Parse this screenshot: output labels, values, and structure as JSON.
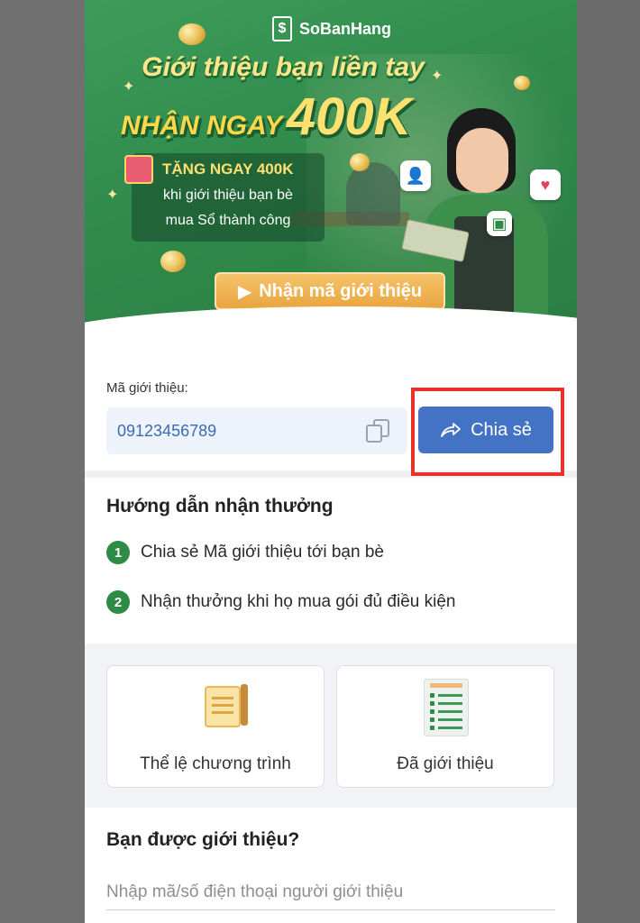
{
  "brand": {
    "name": "SoBanHang",
    "logo_glyph": "$"
  },
  "banner": {
    "headline_line1": "Giới thiệu bạn liền tay",
    "headline_line2_prefix": "NHẬN NGAY",
    "headline_line2_amount": "400K",
    "promo_title": "TẶNG NGAY 400K",
    "promo_line1": "khi giới thiệu bạn bè",
    "promo_line2": "mua Sổ thành công",
    "cta_label": "Nhận mã giới thiệu",
    "cta_icon": "play-triangle-icon"
  },
  "referral": {
    "label": "Mã giới thiệu:",
    "code": "09123456789",
    "copy_icon": "copy-icon",
    "share_label": "Chia sẻ",
    "share_icon": "share-arrow-icon"
  },
  "guide": {
    "title": "Hướng dẫn nhận thưởng",
    "steps": [
      {
        "num": "1",
        "text": "Chia sẻ Mã giới thiệu tới bạn bè"
      },
      {
        "num": "2",
        "text": "Nhận thưởng khi họ mua gói đủ điều kiện"
      }
    ]
  },
  "cards": [
    {
      "label": "Thể lệ chương trình",
      "icon": "scroll-icon"
    },
    {
      "label": "Đã giới thiệu",
      "icon": "checklist-icon"
    }
  ],
  "referred": {
    "title": "Bạn được giới thiệu?",
    "input_placeholder": "Nhập mã/số điện thoại người giới thiệu"
  },
  "colors": {
    "brand_green": "#2f8a4b",
    "accent_blue": "#4472c4",
    "highlight_red": "#e8332a",
    "cta_orange": "#e9a540"
  }
}
